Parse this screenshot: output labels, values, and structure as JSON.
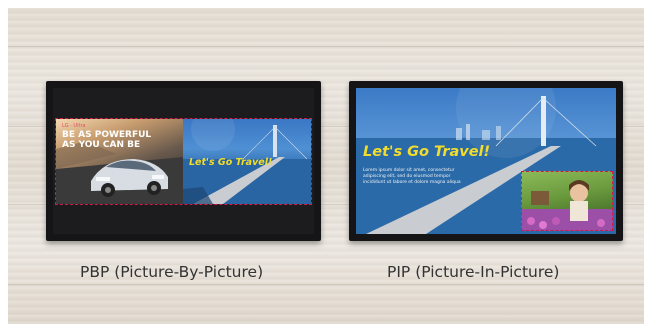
{
  "captions": {
    "pbp": "PBP (Picture-By-Picture)",
    "pip": "PIP (Picture-In-Picture)"
  },
  "pbp_screen": {
    "left_tag": "LG · Ultra",
    "left_headline_1": "BE AS POWERFUL",
    "left_headline_2": "AS YOU CAN BE",
    "right_title": "Let's Go Travel!"
  },
  "pip_screen": {
    "title": "Let's Go Travel!",
    "body_lines": [
      "Lorem ipsum dolor sit amet, consectetur",
      "adipiscing elit, sed do eiusmod tempor",
      "incididunt ut labore et dolore magna aliqua"
    ]
  },
  "colors": {
    "highlight_dashed_border": "#d01a4a",
    "title_yellow": "#f2dc2c",
    "bezel": "#151517"
  }
}
